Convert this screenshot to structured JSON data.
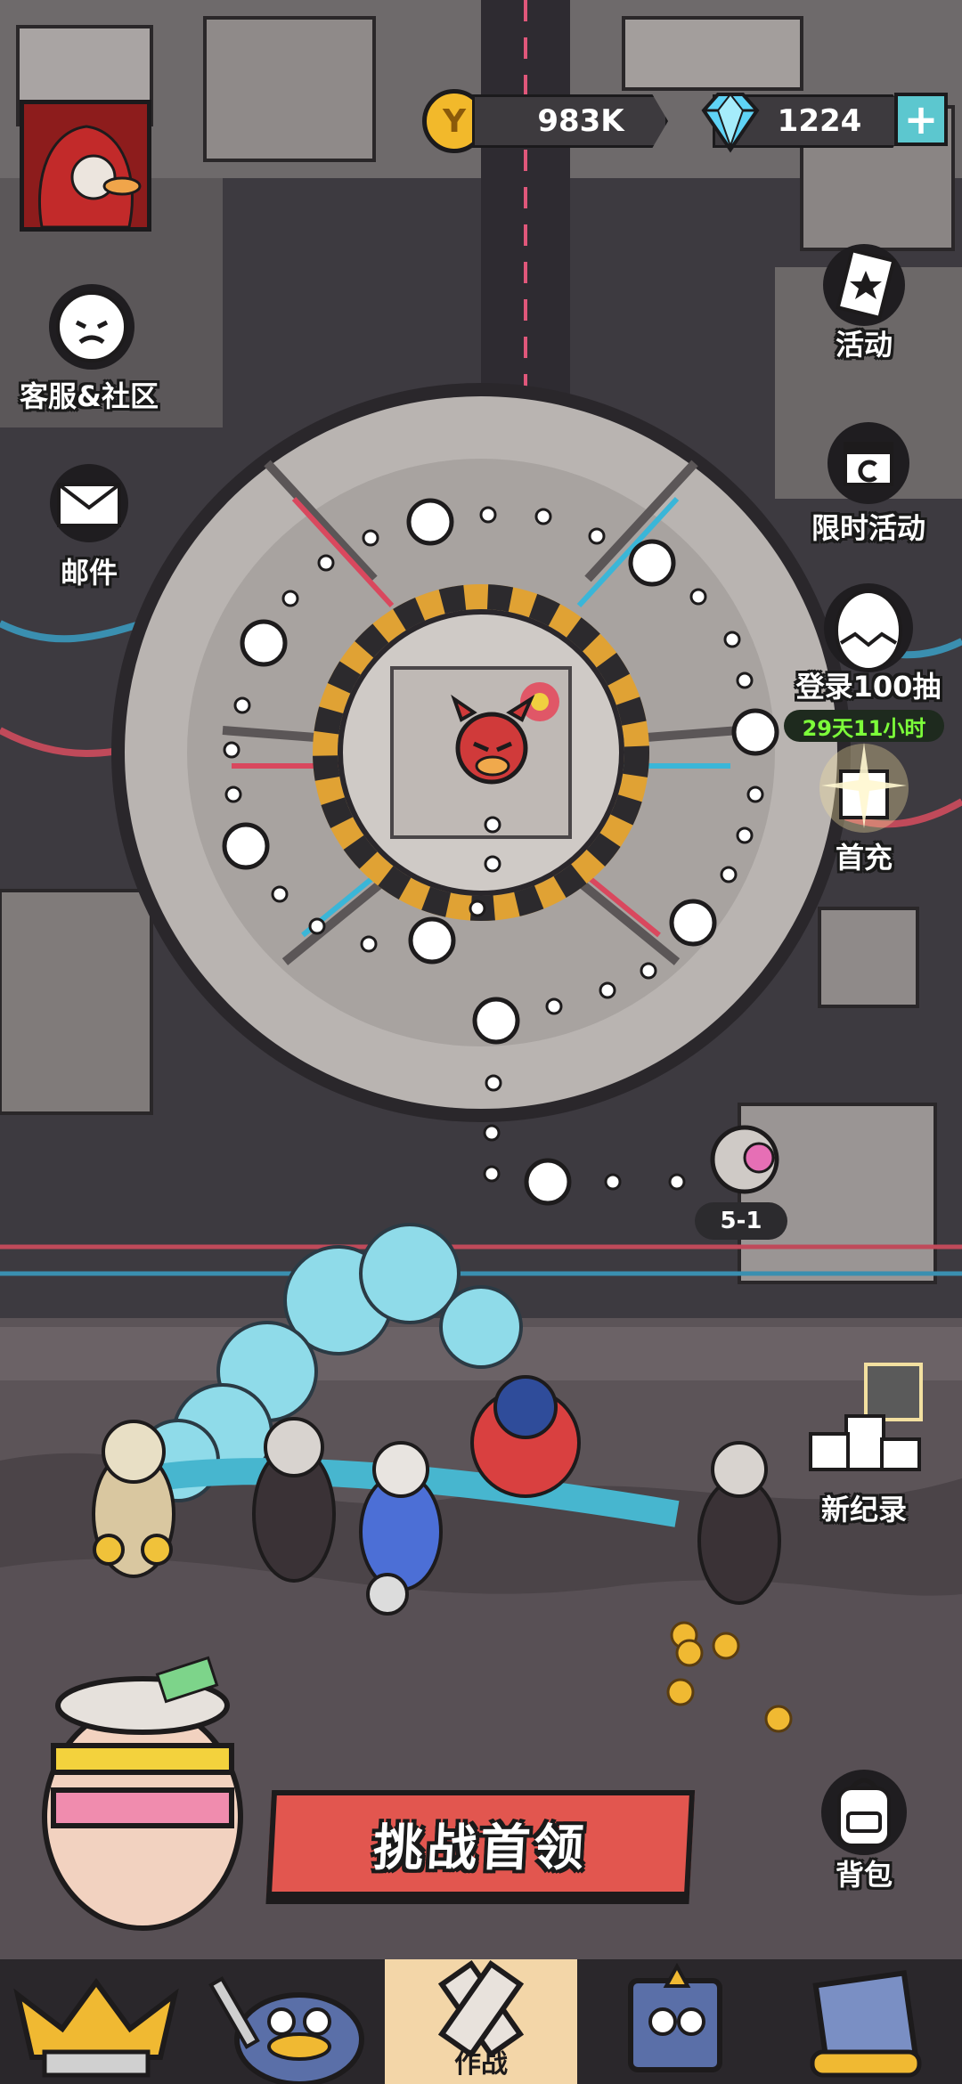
{
  "currency": {
    "gold": "983K",
    "gems": "1224",
    "gold_color": "#f2b92b",
    "gem_color": "#5fd3f6"
  },
  "left_menu": {
    "support_label": "客服&社区",
    "mail_label": "邮件"
  },
  "right_menu": {
    "events_label": "活动",
    "limited_events_label": "限时活动",
    "login_draw_label": "登录100抽",
    "login_draw_timer": "29天11小时",
    "first_recharge_label": "首充",
    "new_record_label": "新纪录",
    "backpack_label": "背包"
  },
  "map": {
    "stage_label": "5-1"
  },
  "actions": {
    "challenge_boss_label": "挑战首领"
  },
  "tabbar": {
    "active_tab_label": "作战",
    "active_color": "#f3d6a8"
  }
}
